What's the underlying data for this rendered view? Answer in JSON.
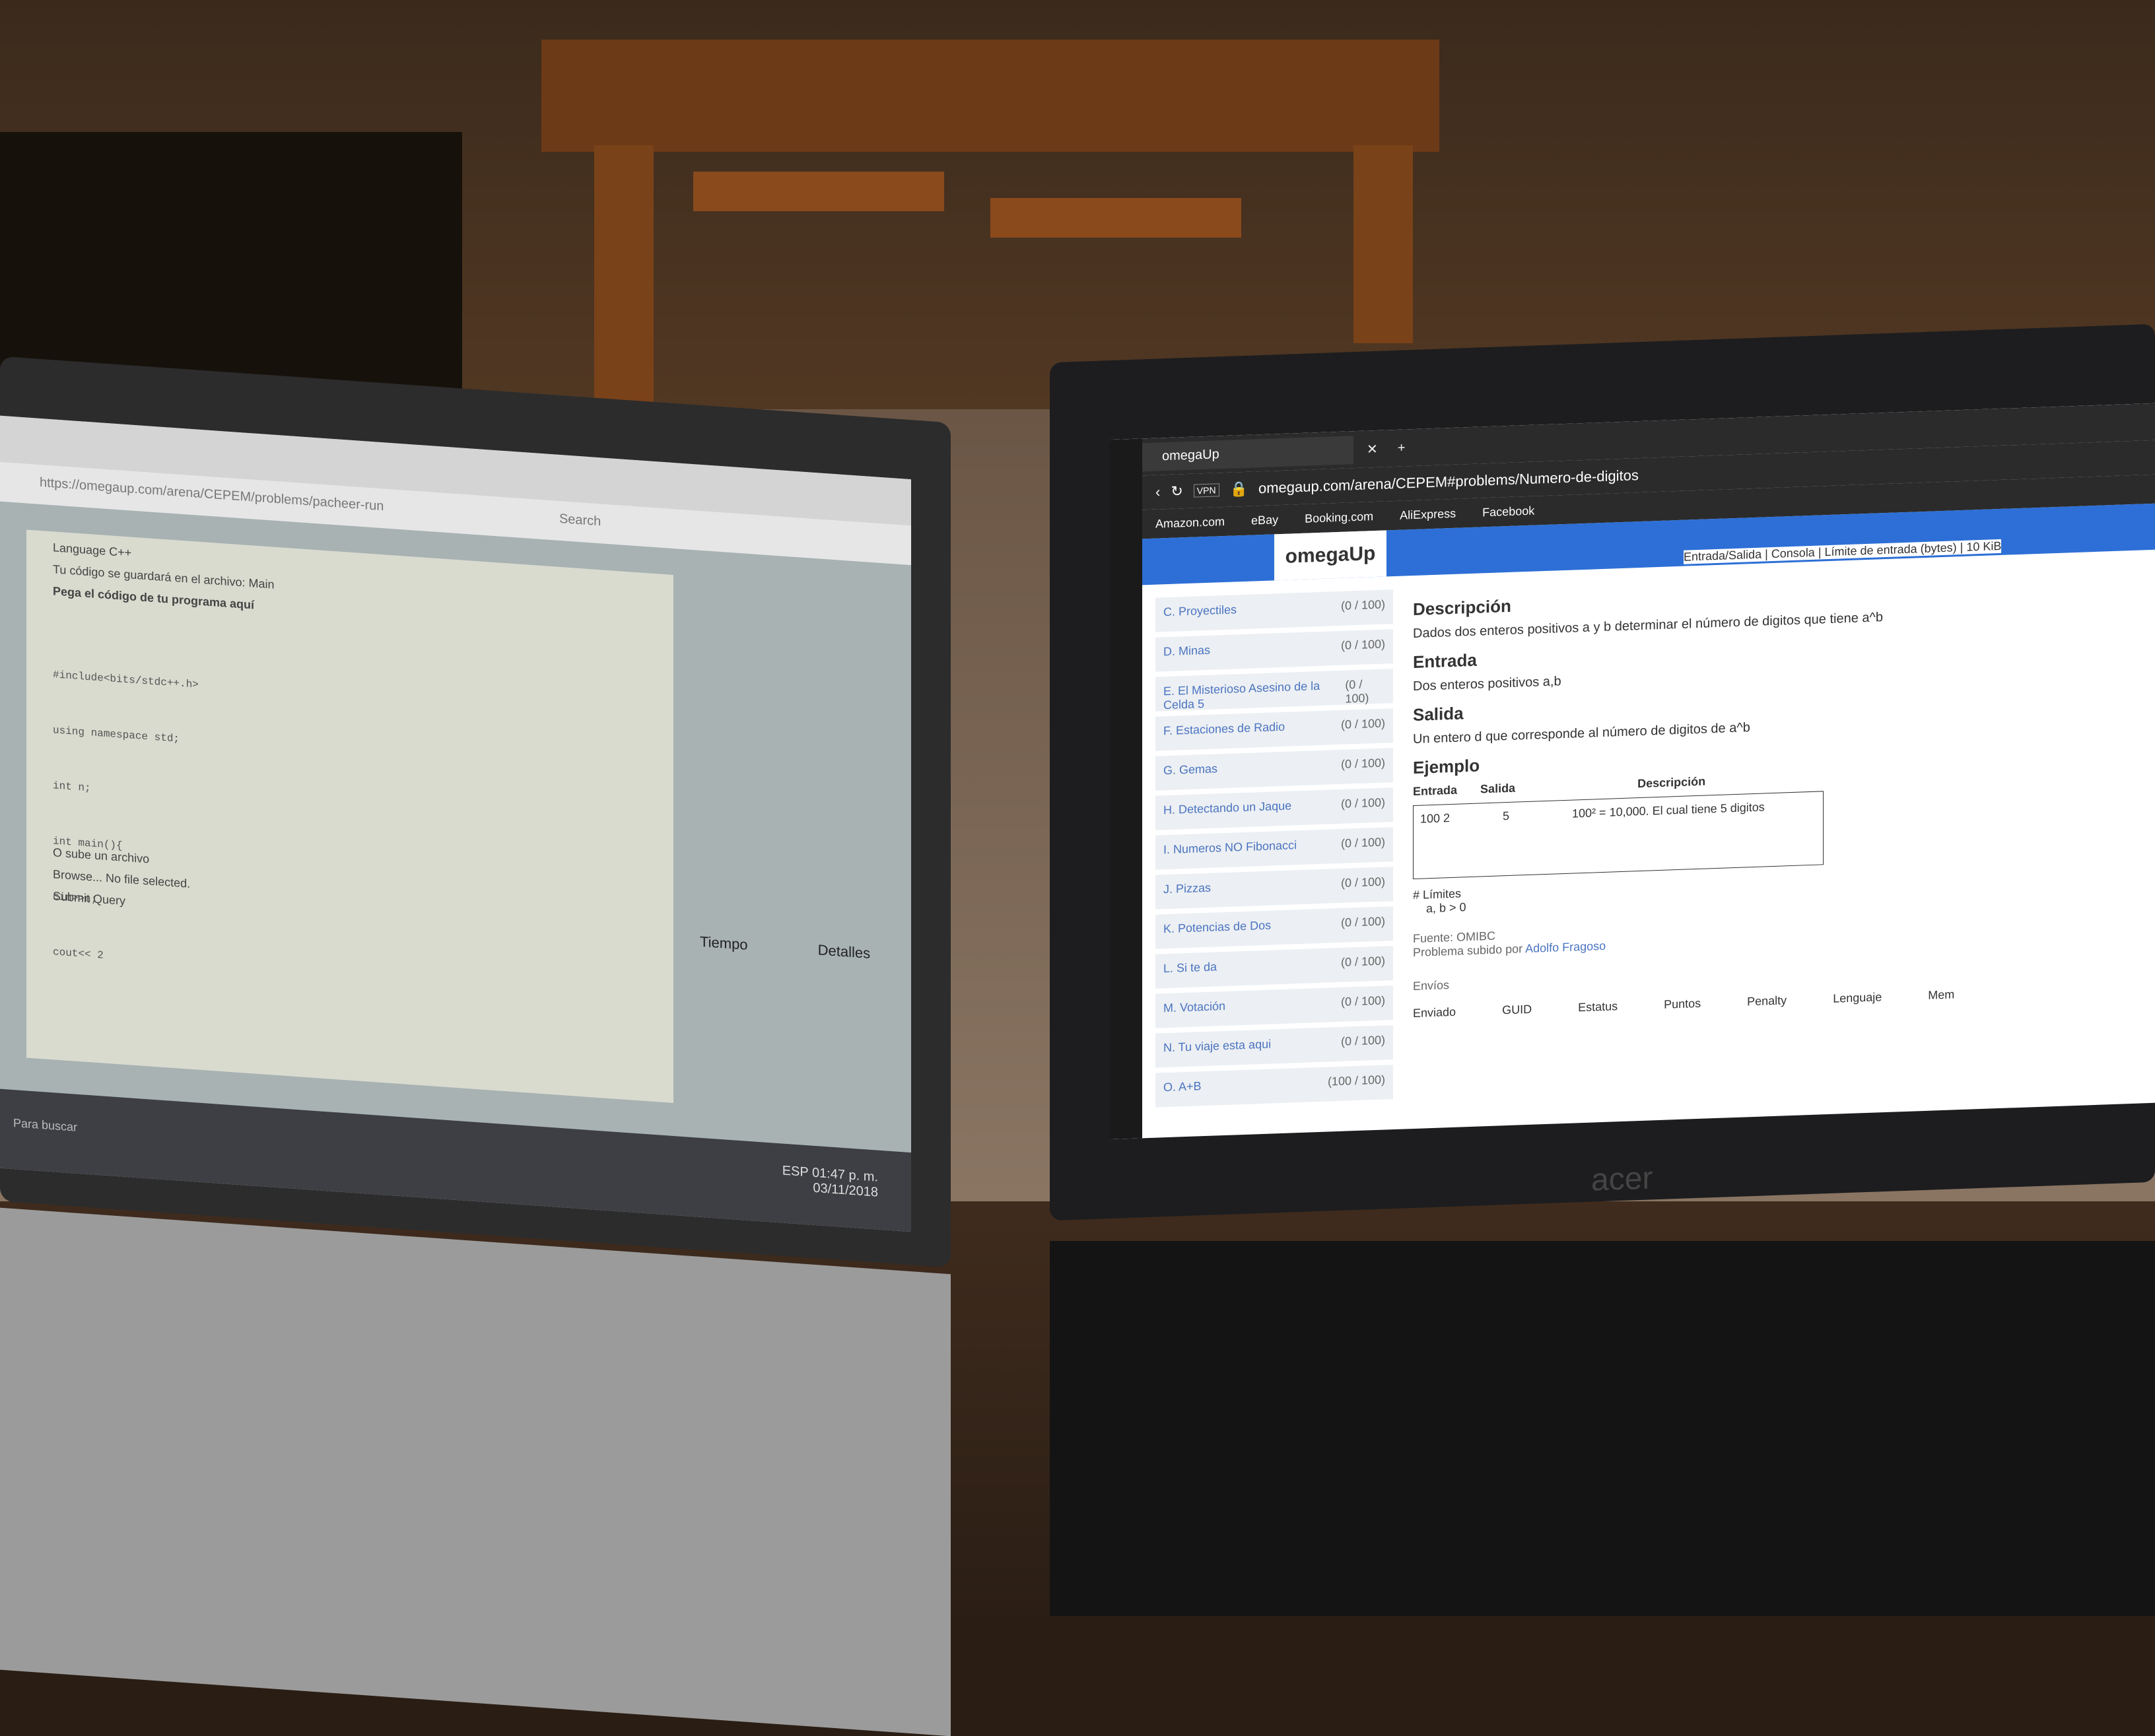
{
  "left_laptop": {
    "url": "https://omegaup.com/arena/CEPEM/problems/pacheer-run",
    "search_placeholder": "Search",
    "dialog": {
      "language_label": "Language",
      "language_value": "C++",
      "hint": "Tu código se guardará en el archivo: Main",
      "title": "Pega el código de tu programa aquí",
      "code_lines": [
        "#include<bits/stdc++.h>",
        "using namespace std;",
        "int n;",
        "int main(){",
        "cin>>n;",
        "cout<< 2"
      ],
      "upload_label": "O sube un archivo",
      "browse_label": "Browse...",
      "no_file": "No file selected.",
      "submit_label": "Submit Query"
    },
    "table_headers": [
      "Tiempo",
      "Detalles"
    ],
    "taskbar": {
      "search_text": "Para buscar",
      "lang": "ESP",
      "time": "01:47 p. m.",
      "date": "03/11/2018"
    }
  },
  "right_laptop": {
    "tab_title": "omegaUp",
    "url": "omegaup.com/arena/CEPEM#problems/Numero-de-digitos",
    "vpn_badge": "VPN",
    "bookmarks": [
      "Amazon.com",
      "eBay",
      "Booking.com",
      "AliExpress",
      "Facebook"
    ],
    "logo": "omegaUp",
    "top_headers": [
      "Entrada/Salida",
      "Consola",
      "Límite de entrada (bytes)",
      "10 KiB"
    ],
    "problems": [
      {
        "name": "C. Proyectiles",
        "score": "(0 / 100)"
      },
      {
        "name": "D. Minas",
        "score": "(0 / 100)"
      },
      {
        "name": "E. El Misterioso Asesino de la Celda 5",
        "score": "(0 / 100)"
      },
      {
        "name": "F. Estaciones de Radio",
        "score": "(0 / 100)"
      },
      {
        "name": "G. Gemas",
        "score": "(0 / 100)"
      },
      {
        "name": "H. Detectando un Jaque",
        "score": "(0 / 100)"
      },
      {
        "name": "I. Numeros NO Fibonacci",
        "score": "(0 / 100)"
      },
      {
        "name": "J. Pizzas",
        "score": "(0 / 100)"
      },
      {
        "name": "K. Potencias de Dos",
        "score": "(0 / 100)"
      },
      {
        "name": "L. Si te da",
        "score": "(0 / 100)"
      },
      {
        "name": "M. Votación",
        "score": "(0 / 100)"
      },
      {
        "name": "N. Tu viaje esta aqui",
        "score": "(0 / 100)"
      },
      {
        "name": "O. A+B",
        "score": "(100 / 100)"
      }
    ],
    "statement": {
      "desc_title": "Descripción",
      "desc_text": "Dados dos enteros positivos a y b determinar el número de digitos que tiene a^b",
      "in_title": "Entrada",
      "in_text": "Dos enteros positivos a,b",
      "out_title": "Salida",
      "out_text": "Un entero d que corresponde al número de digitos de a^b",
      "ex_title": "Ejemplo",
      "ex_headers": [
        "Entrada",
        "Salida",
        "Descripción"
      ],
      "ex_in": "100 2",
      "ex_out": "5",
      "ex_desc": "100² = 10,000. El cual tiene 5 digitos",
      "limits_title": "# Límites",
      "limits_item": "a, b > 0",
      "source": "Fuente: OMIBC",
      "uploaded_by": "Problema subido por",
      "author": "Adolfo Fragoso",
      "runs_title": "Envíos",
      "runs_headers": [
        "Enviado",
        "GUID",
        "Estatus",
        "Puntos",
        "Penalty",
        "Lenguaje",
        "Mem"
      ]
    },
    "brand": "acer"
  }
}
